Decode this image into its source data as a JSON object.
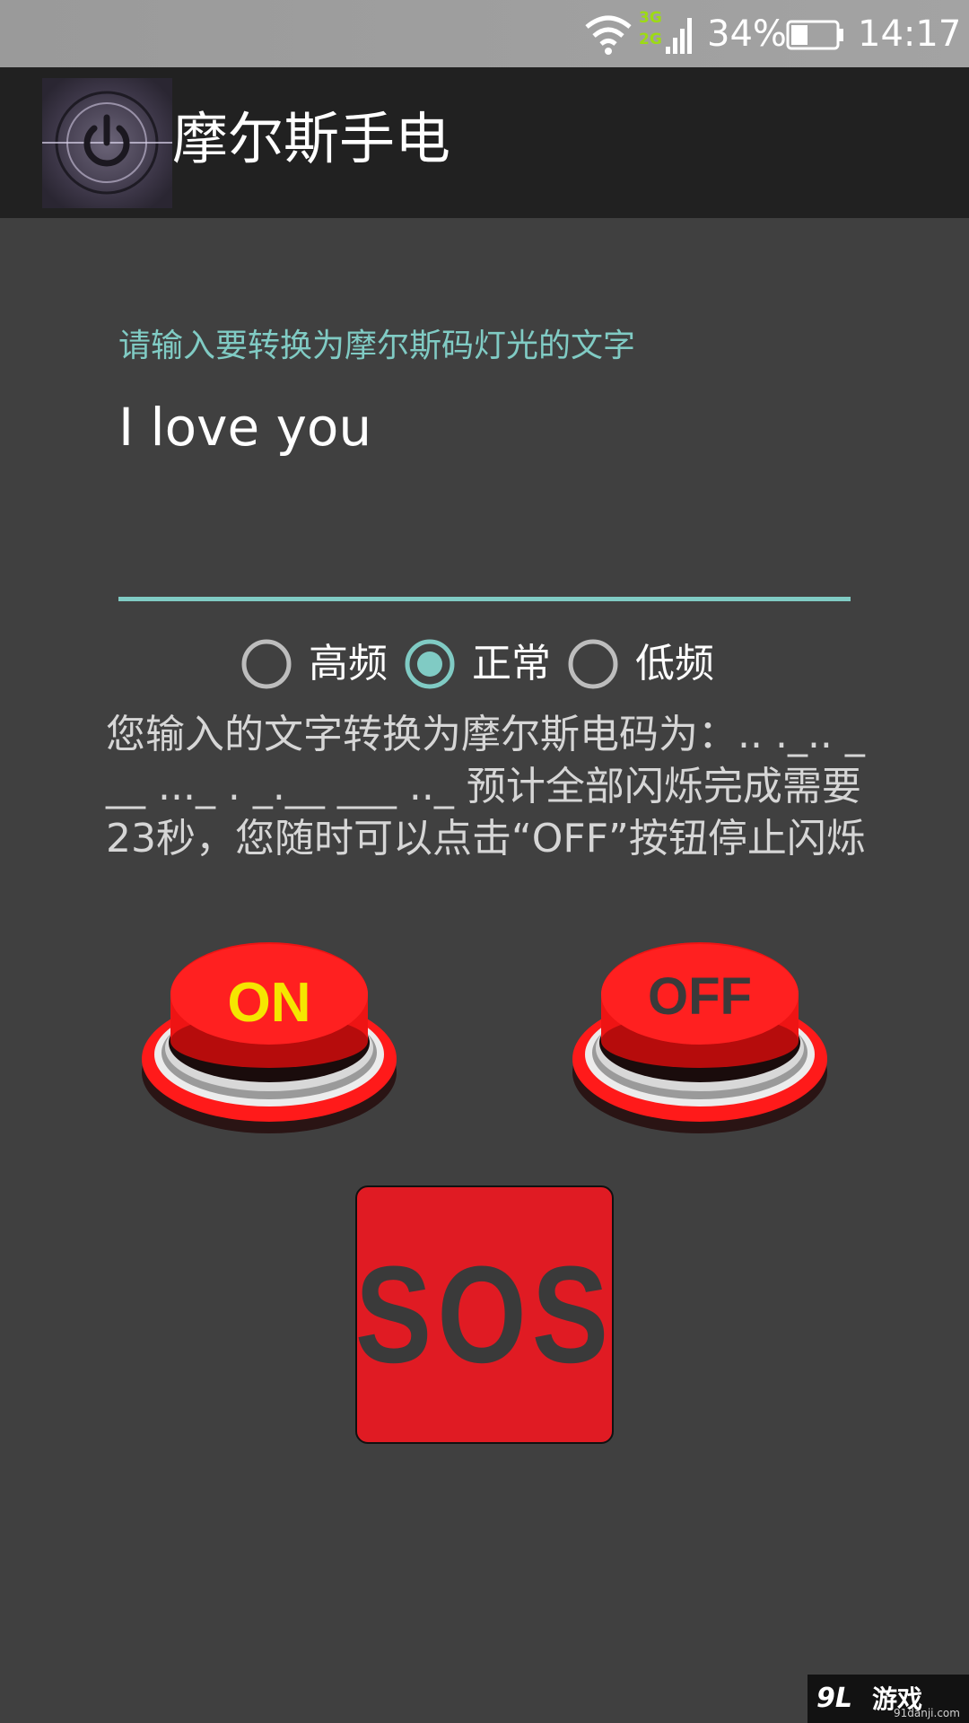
{
  "status_bar": {
    "network_3g": "3G",
    "network_2g": "2G",
    "battery_percent": "34%",
    "time": "14:17",
    "icons": [
      "wifi-icon",
      "signal-icon",
      "battery-icon"
    ]
  },
  "app_bar": {
    "title": "摩尔斯手电",
    "icon": "power-icon"
  },
  "input": {
    "label": "请输入要转换为摩尔斯码灯光的文字",
    "value": "I love you"
  },
  "frequency": {
    "options": [
      {
        "label": "高频",
        "selected": false
      },
      {
        "label": "正常",
        "selected": true
      },
      {
        "label": "低频",
        "selected": false
      }
    ]
  },
  "result": {
    "text": "您输入的文字转换为摩尔斯电码为：.. ._.. ___ ..._ .   _.__ ___ .._ 预计全部闪烁完成需要23秒，您随时可以点击“OFF”按钮停止闪烁"
  },
  "buttons": {
    "on_label": "ON",
    "off_label": "OFF",
    "sos_label": "SOS"
  },
  "watermark": {
    "brand": "游戏",
    "site": "91danji.com"
  },
  "colors": {
    "accent": "#80cbc4",
    "background": "#404040",
    "app_bar": "#212121",
    "button_red": "#e01b23",
    "on_text": "#f5e600"
  }
}
